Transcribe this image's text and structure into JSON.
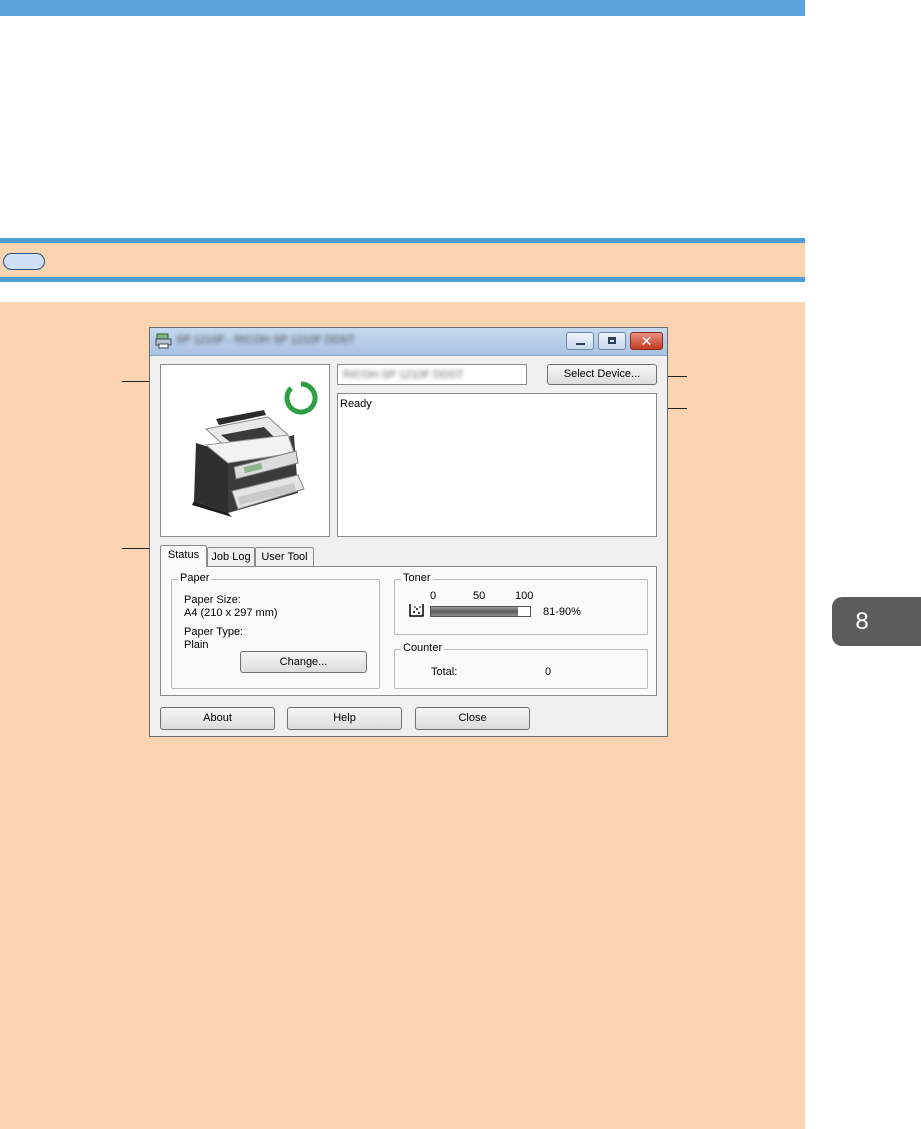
{
  "chapter": {
    "number": "8"
  },
  "window": {
    "title": "SP 1210F - RICOH SP 1210F DDST",
    "device_name": "RICOH SP 1210F DDST",
    "select_device_label": "Select Device...",
    "status_message": "Ready",
    "status_ring_color": "#2ea043",
    "tabs": [
      {
        "label": "Status",
        "selected": true
      },
      {
        "label": "Job Log",
        "selected": false
      },
      {
        "label": "User Tool",
        "selected": false
      }
    ],
    "paper": {
      "group_title": "Paper",
      "size_label": "Paper Size:",
      "size_value": "A4 (210 x 297 mm)",
      "type_label": "Paper Type:",
      "type_value": "Plain",
      "change_label": "Change..."
    },
    "toner": {
      "group_title": "Toner",
      "scale": [
        "0",
        "50",
        "100"
      ],
      "level_text": "81-90%",
      "level_fraction": 0.88
    },
    "counter": {
      "group_title": "Counter",
      "total_label": "Total:",
      "total_value": "0"
    },
    "buttons": {
      "about": "About",
      "help": "Help",
      "close": "Close"
    }
  }
}
